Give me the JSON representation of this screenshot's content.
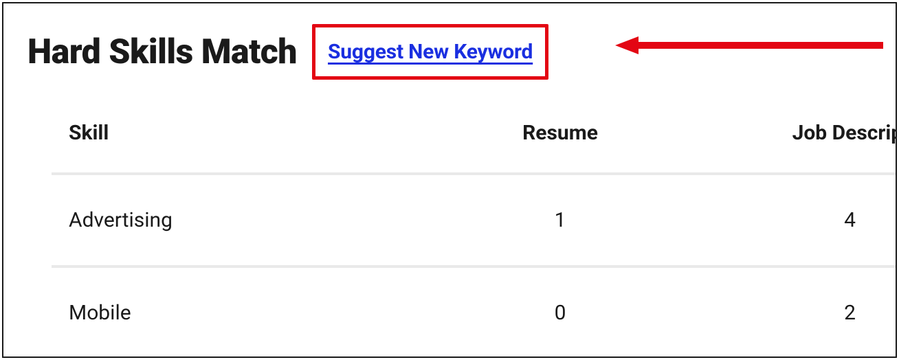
{
  "header": {
    "title": "Hard Skills Match",
    "suggest_link": "Suggest New Keyword"
  },
  "table": {
    "columns": {
      "skill": "Skill",
      "resume": "Resume",
      "job_description": "Job Description"
    },
    "rows": [
      {
        "skill": "Advertising",
        "resume": "1",
        "job_description": "4"
      },
      {
        "skill": "Mobile",
        "resume": "0",
        "job_description": "2"
      }
    ]
  },
  "annotation": {
    "highlight_color": "#e30613",
    "arrow_color": "#e30613"
  }
}
